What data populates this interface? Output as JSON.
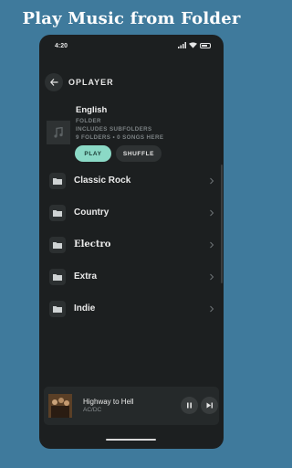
{
  "promo": {
    "title": "Play Music from Folder"
  },
  "status_bar": {
    "time": "4:20"
  },
  "header": {
    "title": "OPLAYER"
  },
  "folder": {
    "name": "English",
    "type": "FOLDER",
    "subfolders_note": "INCLUDES SUBFOLDERS",
    "counts": "9 FOLDERS • 0 SONGS HERE",
    "play_label": "PLAY",
    "shuffle_label": "SHUFFLE"
  },
  "subfolders": [
    {
      "label": "Classic Rock"
    },
    {
      "label": "Country"
    },
    {
      "label": "Electro"
    },
    {
      "label": "Extra"
    },
    {
      "label": "Indie"
    }
  ],
  "now_playing": {
    "title": "Highway to Hell",
    "artist": "AC/DC"
  },
  "colors": {
    "accent": "#8bd9c6",
    "background": "#1c1f20",
    "page": "#3f7a9c"
  },
  "icons": [
    "back-arrow-icon",
    "music-note-icon",
    "folder-icon",
    "chevron-right-icon",
    "pause-icon",
    "skip-next-icon"
  ]
}
